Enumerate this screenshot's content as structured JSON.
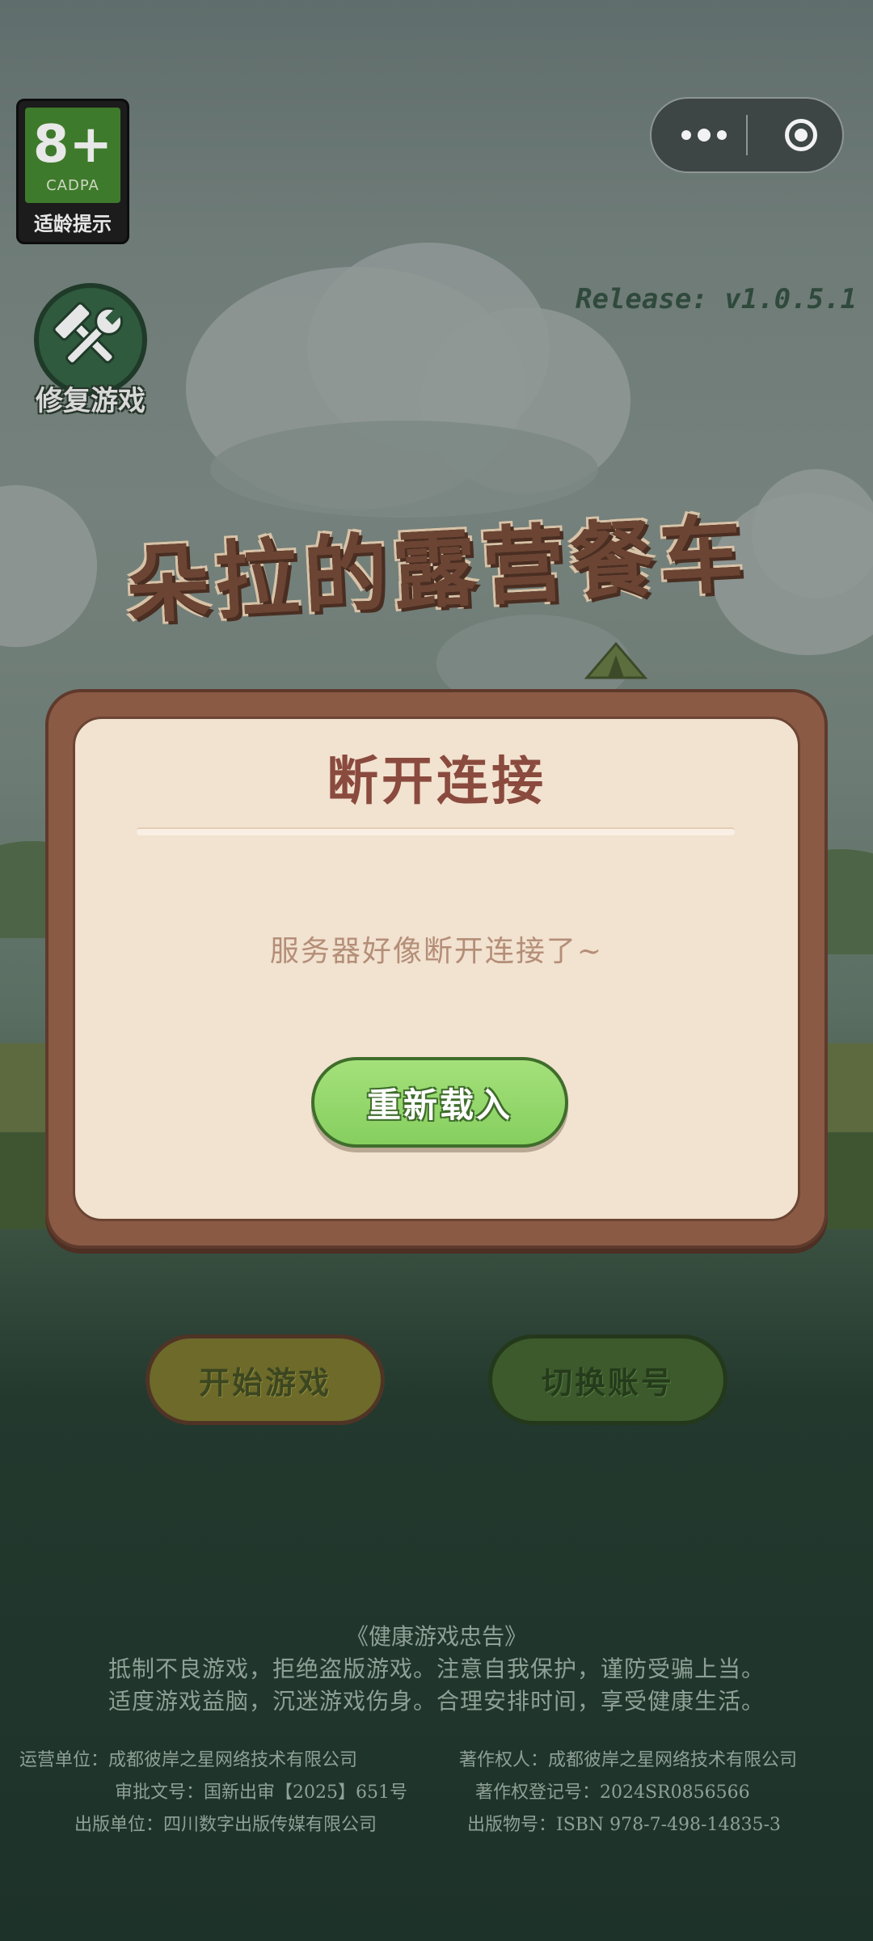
{
  "age_badge": {
    "rating": "8+",
    "org": "CADPA",
    "label": "适龄提示"
  },
  "mini_program_capsule": {
    "more_icon": "more-dots-icon",
    "close_icon": "target-close-icon"
  },
  "release": "Release: v1.0.5.1",
  "repair": {
    "icon": "hammer-wrench-icon",
    "label": "修复游戏"
  },
  "game_title": "朵拉的露营餐车",
  "modal": {
    "title": "断开连接",
    "message": "服务器好像断开连接了~",
    "button_label": "重新载入"
  },
  "actions": {
    "start_label": "开始游戏",
    "switch_label": "切换账号"
  },
  "footer": {
    "health_title": "《健康游戏忠告》",
    "health_line1": "抵制不良游戏，拒绝盗版游戏。注意自我保护，谨防受骗上当。",
    "health_line2": "适度游戏益脑，沉迷游戏伤身。合理安排时间，享受健康生活。",
    "operator": "运营单位：成都彼岸之星网络技术有限公司",
    "copyright_owner": "著作权人：成都彼岸之星网络技术有限公司",
    "approval_no": "审批文号：国新出审【2025】651号",
    "copyright_reg": "著作权登记号：2024SR0856566",
    "publisher": "出版单位：四川数字出版传媒有限公司",
    "isbn": "出版物号：ISBN 978-7-498-14835-3"
  },
  "colors": {
    "modal_frame": "#8a5a45",
    "modal_inner": "#f2e2d0",
    "reload_green": "#8fd668",
    "title_brown": "#6b4433"
  }
}
